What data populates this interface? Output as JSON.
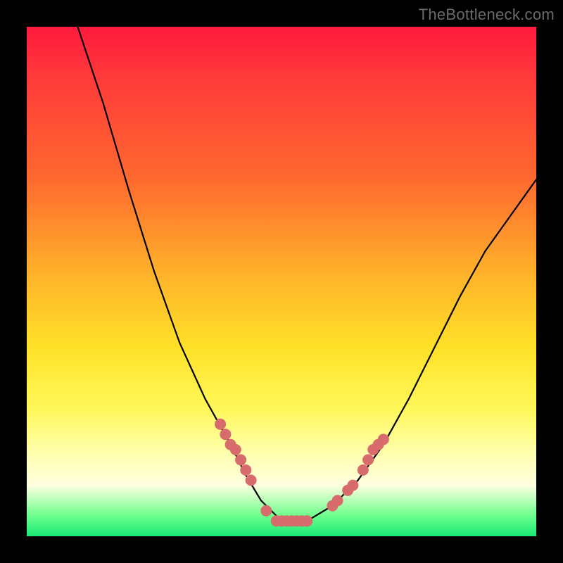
{
  "watermark": "TheBottleneck.com",
  "chart_data": {
    "type": "line",
    "title": "",
    "xlabel": "",
    "ylabel": "",
    "xlim": [
      0,
      100
    ],
    "ylim": [
      0,
      100
    ],
    "grid": false,
    "series": [
      {
        "name": "curve",
        "x": [
          10,
          15,
          20,
          25,
          30,
          35,
          40,
          43,
          46,
          49,
          51,
          55,
          60,
          65,
          70,
          75,
          80,
          85,
          90,
          95,
          100
        ],
        "values": [
          100,
          85,
          68,
          52,
          38,
          27,
          18,
          12,
          7,
          4,
          3,
          3,
          6,
          11,
          18,
          27,
          37,
          47,
          56,
          63,
          70
        ]
      }
    ],
    "markers": {
      "comment": "clustered dots on both branches near the trough",
      "x": [
        38,
        39,
        40,
        41,
        42,
        43,
        44,
        47,
        49,
        50,
        51,
        52,
        53,
        54,
        55,
        60,
        61,
        63,
        64,
        66,
        67,
        68,
        69,
        70
      ],
      "values": [
        22,
        20,
        18,
        17,
        15,
        13,
        11,
        5,
        3,
        3,
        3,
        3,
        3,
        3,
        3,
        6,
        7,
        9,
        10,
        13,
        15,
        17,
        18,
        19
      ]
    },
    "gradient_stops": [
      {
        "pos": 0,
        "color": "#ff1a3e"
      },
      {
        "pos": 10,
        "color": "#ff3a3a"
      },
      {
        "pos": 30,
        "color": "#ff6a2f"
      },
      {
        "pos": 48,
        "color": "#ffb02a"
      },
      {
        "pos": 63,
        "color": "#ffe128"
      },
      {
        "pos": 75,
        "color": "#fff85a"
      },
      {
        "pos": 84,
        "color": "#ffffb0"
      },
      {
        "pos": 90,
        "color": "#ffffe0"
      },
      {
        "pos": 96,
        "color": "#6cff8c"
      },
      {
        "pos": 100,
        "color": "#17e874"
      }
    ],
    "marker_color": "#d86b6b",
    "curve_color": "#000000"
  }
}
